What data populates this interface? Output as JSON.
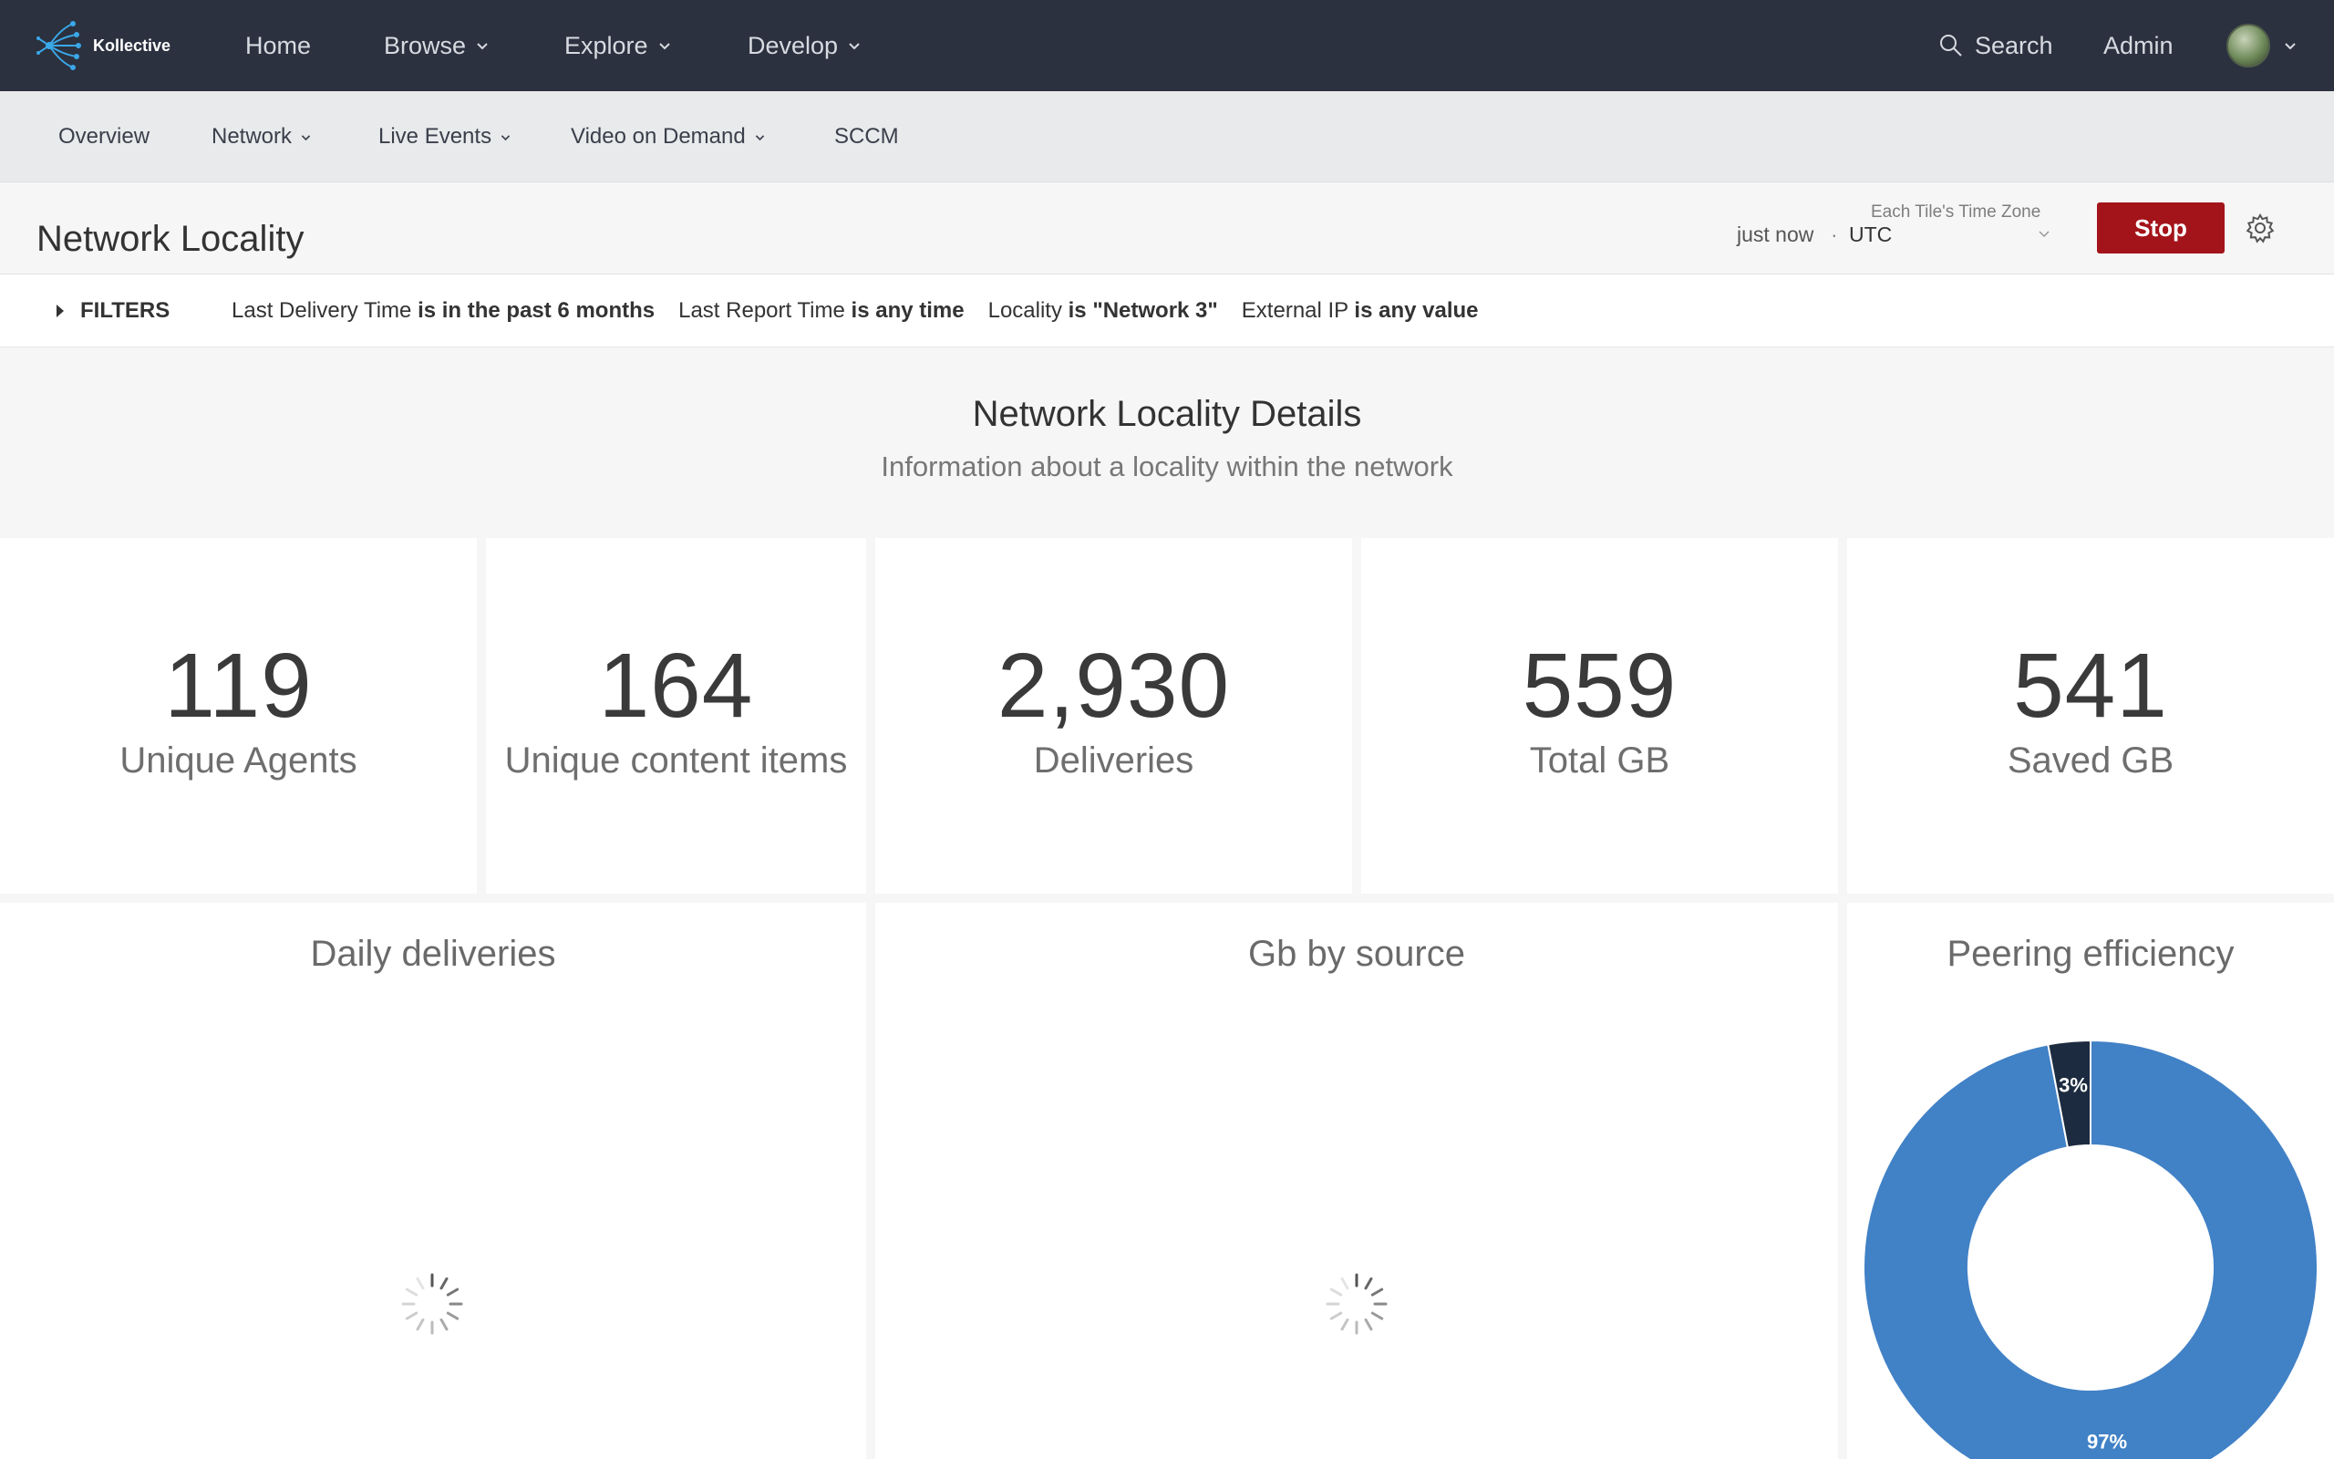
{
  "brand": {
    "name": "Kollective"
  },
  "topnav": {
    "items": [
      {
        "label": "Home",
        "has_menu": false
      },
      {
        "label": "Browse",
        "has_menu": true
      },
      {
        "label": "Explore",
        "has_menu": true
      },
      {
        "label": "Develop",
        "has_menu": true
      }
    ],
    "search_label": "Search",
    "admin_label": "Admin"
  },
  "subnav": {
    "items": [
      {
        "label": "Overview",
        "has_menu": false
      },
      {
        "label": "Network",
        "has_menu": true
      },
      {
        "label": "Live Events",
        "has_menu": true
      },
      {
        "label": "Video on Demand",
        "has_menu": true
      },
      {
        "label": "SCCM",
        "has_menu": false
      }
    ]
  },
  "header": {
    "title": "Network Locality",
    "last_updated": "just now",
    "timezone_label": "Each Tile's Time Zone",
    "timezone_value": "UTC",
    "stop_label": "Stop"
  },
  "filters": {
    "label": "FILTERS",
    "items": [
      {
        "field": "Last Delivery Time",
        "condition": "is in the past 6 months"
      },
      {
        "field": "Last Report Time",
        "condition": "is any time"
      },
      {
        "field": "Locality",
        "condition": "is \"Network 3\""
      },
      {
        "field": "External IP",
        "condition": "is any value"
      }
    ]
  },
  "section": {
    "title": "Network Locality Details",
    "subtitle": "Information about a locality within the network"
  },
  "stats": [
    {
      "value": "119",
      "label": "Unique Agents"
    },
    {
      "value": "164",
      "label": "Unique content items"
    },
    {
      "value": "2,930",
      "label": "Deliveries"
    },
    {
      "value": "559",
      "label": "Total GB"
    },
    {
      "value": "541",
      "label": "Saved GB"
    }
  ],
  "tiles": {
    "daily_deliveries": {
      "title": "Daily deliveries"
    },
    "gb_by_source": {
      "title": "Gb by source"
    },
    "peering_efficiency": {
      "title": "Peering efficiency"
    }
  },
  "colors": {
    "nav_bg": "#2b313f",
    "stop_button": "#a3141a",
    "donut_primary": "#4181c6",
    "donut_secondary": "#1c2b3f"
  },
  "chart_data": {
    "type": "pie",
    "title": "Peering efficiency",
    "slices": [
      {
        "label": "97%",
        "value": 97,
        "color": "#4181c6"
      },
      {
        "label": "3%",
        "value": 3,
        "color": "#1c2b3f"
      }
    ]
  }
}
